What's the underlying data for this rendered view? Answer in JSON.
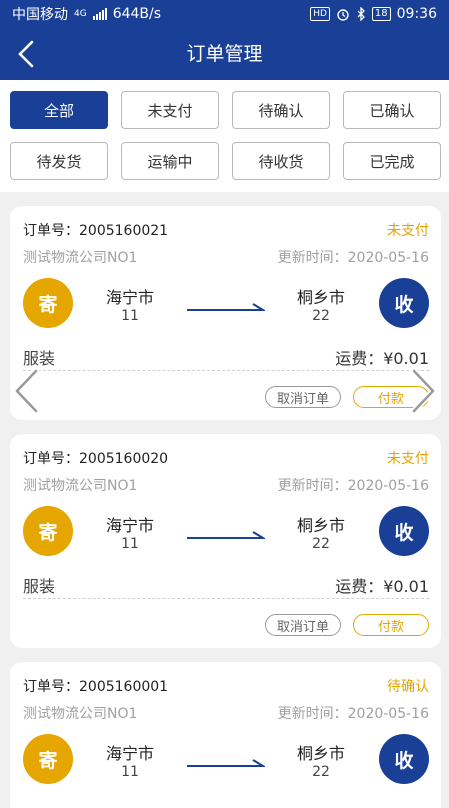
{
  "statusbar": {
    "carrier": "中国移动",
    "network": "4G",
    "speed": "644B/s",
    "hd": "HD",
    "battery": "18",
    "time": "09:36"
  },
  "header": {
    "title": "订单管理"
  },
  "filters": [
    {
      "label": "全部",
      "active": true
    },
    {
      "label": "未支付",
      "active": false
    },
    {
      "label": "待确认",
      "active": false
    },
    {
      "label": "已确认",
      "active": false
    },
    {
      "label": "待发货",
      "active": false
    },
    {
      "label": "运输中",
      "active": false
    },
    {
      "label": "待收货",
      "active": false
    },
    {
      "label": "已完成",
      "active": false
    }
  ],
  "orders": [
    {
      "order_no": "订单号：2005160021",
      "status": "未支付",
      "company": "测试物流公司NO1",
      "updated": "更新时间：2020-05-16",
      "send_label": "寄",
      "recv_label": "收",
      "from_city": "海宁市",
      "from_code": "11",
      "to_city": "桐乡市",
      "to_code": "22",
      "goods": "服装",
      "fee": "运费：¥0.01",
      "cancel_label": "取消订单",
      "pay_label": "付款"
    },
    {
      "order_no": "订单号：2005160020",
      "status": "未支付",
      "company": "测试物流公司NO1",
      "updated": "更新时间：2020-05-16",
      "send_label": "寄",
      "recv_label": "收",
      "from_city": "海宁市",
      "from_code": "11",
      "to_city": "桐乡市",
      "to_code": "22",
      "goods": "服装",
      "fee": "运费：¥0.01",
      "cancel_label": "取消订单",
      "pay_label": "付款"
    },
    {
      "order_no": "订单号：2005160001",
      "status": "待确认",
      "company": "测试物流公司NO1",
      "updated": "更新时间：2020-05-16",
      "send_label": "寄",
      "recv_label": "收",
      "from_city": "海宁市",
      "from_code": "11",
      "to_city": "桐乡市",
      "to_code": "22"
    }
  ],
  "colors": {
    "primary": "#1a3f96",
    "accent": "#e6a600",
    "background": "#f0f0f0"
  },
  "icons": {
    "back": "chevron-left-icon",
    "prev": "chevron-left-icon",
    "next": "chevron-right-icon"
  }
}
